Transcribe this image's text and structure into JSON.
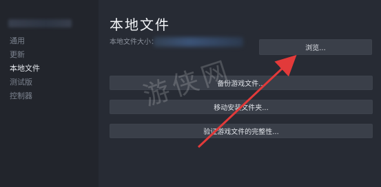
{
  "sidebar": {
    "items": [
      {
        "label": "通用"
      },
      {
        "label": "更新"
      },
      {
        "label": "本地文件"
      },
      {
        "label": "测试版"
      },
      {
        "label": "控制器"
      }
    ]
  },
  "main": {
    "title": "本地文件",
    "size_label": "本地文件大小：",
    "buttons": {
      "browse": "浏览...",
      "backup": "备份游戏文件...",
      "move": "移动安装文件夹...",
      "verify": "验证游戏文件的完整性..."
    }
  },
  "watermark": {
    "text": "游侠网"
  },
  "colors": {
    "background": "#1b1e24",
    "sidebar": "#22252c",
    "panel": "#272b34",
    "button": "#3a3f49",
    "arrow": "#e23a3a"
  }
}
